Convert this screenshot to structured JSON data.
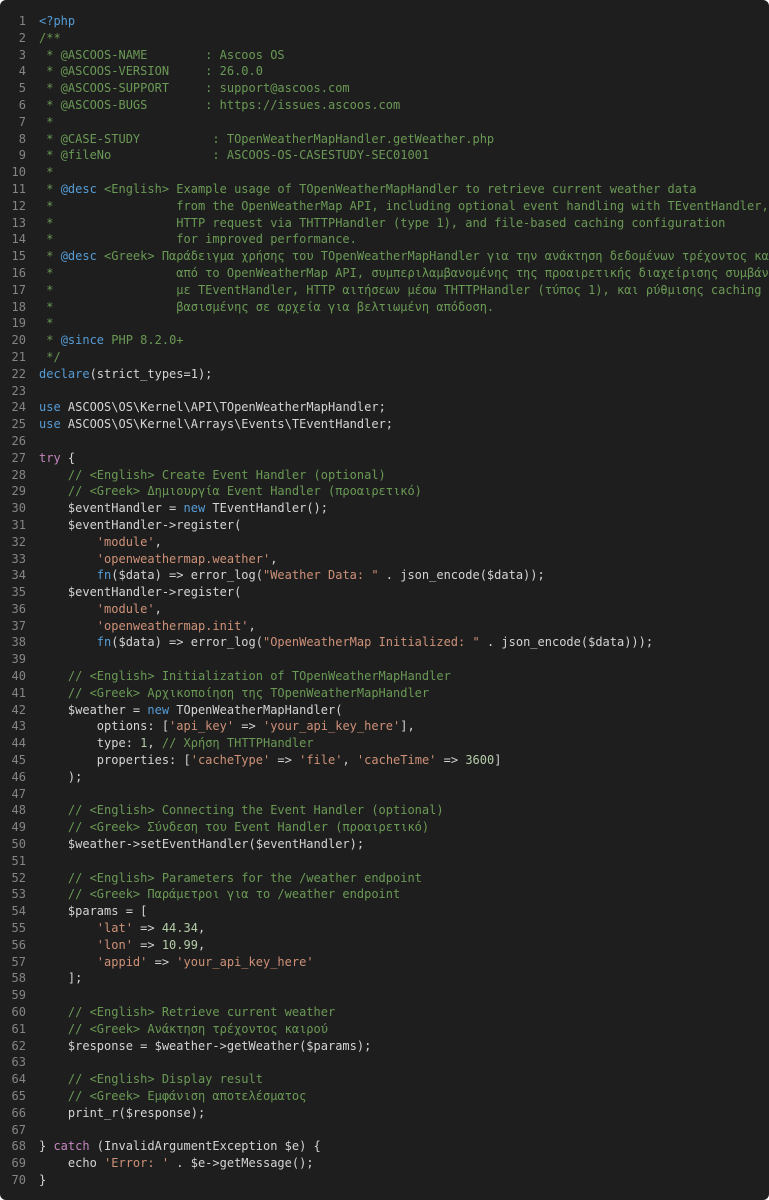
{
  "code_lines": [
    {
      "n": "1",
      "tokens": [
        {
          "t": "<?php",
          "c": "kw"
        }
      ]
    },
    {
      "n": "2",
      "tokens": [
        {
          "t": "/**",
          "c": "cm"
        }
      ]
    },
    {
      "n": "3",
      "tokens": [
        {
          "t": " * @ASCOOS-NAME        : Ascoos OS",
          "c": "cm"
        }
      ]
    },
    {
      "n": "4",
      "tokens": [
        {
          "t": " * @ASCOOS-VERSION     : 26.0.0",
          "c": "cm"
        }
      ]
    },
    {
      "n": "5",
      "tokens": [
        {
          "t": " * @ASCOOS-SUPPORT     : support@ascoos.com",
          "c": "cm"
        }
      ]
    },
    {
      "n": "6",
      "tokens": [
        {
          "t": " * @ASCOOS-BUGS        : https://issues.ascoos.com",
          "c": "cm"
        }
      ]
    },
    {
      "n": "7",
      "tokens": [
        {
          "t": " *",
          "c": "cm"
        }
      ]
    },
    {
      "n": "8",
      "tokens": [
        {
          "t": " * @CASE-STUDY          : TOpenWeatherMapHandler.getWeather.php",
          "c": "cm"
        }
      ]
    },
    {
      "n": "9",
      "tokens": [
        {
          "t": " * @fileNo              : ASCOOS-OS-CASESTUDY-SEC01001",
          "c": "cm"
        }
      ]
    },
    {
      "n": "10",
      "tokens": [
        {
          "t": " *",
          "c": "cm"
        }
      ]
    },
    {
      "n": "11",
      "tokens": [
        {
          "t": " * ",
          "c": "cm"
        },
        {
          "t": "@desc",
          "c": "ck"
        },
        {
          "t": " <English> Example usage of TOpenWeatherMapHandler to retrieve current weather data",
          "c": "cm"
        }
      ]
    },
    {
      "n": "12",
      "tokens": [
        {
          "t": " *                 from the OpenWeatherMap API, including optional event handling with TEventHandler,",
          "c": "cm"
        }
      ]
    },
    {
      "n": "13",
      "tokens": [
        {
          "t": " *                 HTTP request via THTTPHandler (type 1), and file-based caching configuration",
          "c": "cm"
        }
      ]
    },
    {
      "n": "14",
      "tokens": [
        {
          "t": " *                 for improved performance.",
          "c": "cm"
        }
      ]
    },
    {
      "n": "15",
      "tokens": [
        {
          "t": " * ",
          "c": "cm"
        },
        {
          "t": "@desc",
          "c": "ck"
        },
        {
          "t": " <Greek> Παράδειγμα χρήσης του TOpenWeatherMapHandler για την ανάκτηση δεδομένων τρέχοντος καιρού",
          "c": "cm"
        }
      ]
    },
    {
      "n": "16",
      "tokens": [
        {
          "t": " *                 από το OpenWeatherMap API, συμπεριλαμβανομένης της προαιρετικής διαχείρισης συμβάντων",
          "c": "cm"
        }
      ]
    },
    {
      "n": "17",
      "tokens": [
        {
          "t": " *                 με TEventHandler, HTTP αιτήσεων μέσω THTTPHandler (τύπος 1), και ρύθμισης caching",
          "c": "cm"
        }
      ]
    },
    {
      "n": "18",
      "tokens": [
        {
          "t": " *                 βασισμένης σε αρχεία για βελτιωμένη απόδοση.",
          "c": "cm"
        }
      ]
    },
    {
      "n": "19",
      "tokens": [
        {
          "t": " *",
          "c": "cm"
        }
      ]
    },
    {
      "n": "20",
      "tokens": [
        {
          "t": " * ",
          "c": "cm"
        },
        {
          "t": "@since",
          "c": "ck"
        },
        {
          "t": " PHP 8.2.0+",
          "c": "cm"
        }
      ]
    },
    {
      "n": "21",
      "tokens": [
        {
          "t": " */",
          "c": "cm"
        }
      ]
    },
    {
      "n": "22",
      "tokens": [
        {
          "t": "declare",
          "c": "kw"
        },
        {
          "t": "(strict_types=1);",
          "c": ""
        }
      ]
    },
    {
      "n": "23",
      "tokens": []
    },
    {
      "n": "24",
      "tokens": [
        {
          "t": "use",
          "c": "kw"
        },
        {
          "t": " ASCOOS\\OS\\Kernel\\API\\TOpenWeatherMapHandler;",
          "c": ""
        }
      ]
    },
    {
      "n": "25",
      "tokens": [
        {
          "t": "use",
          "c": "kw"
        },
        {
          "t": " ASCOOS\\OS\\Kernel\\Arrays\\Events\\TEventHandler;",
          "c": ""
        }
      ]
    },
    {
      "n": "26",
      "tokens": []
    },
    {
      "n": "27",
      "tokens": [
        {
          "t": "try",
          "c": "ct"
        },
        {
          "t": " {",
          "c": ""
        }
      ]
    },
    {
      "n": "28",
      "tokens": [
        {
          "t": "    // <English> Create Event Handler (optional)",
          "c": "cm"
        }
      ]
    },
    {
      "n": "29",
      "tokens": [
        {
          "t": "    // <Greek> Δημιουργία Event Handler (προαιρετικό)",
          "c": "cm"
        }
      ]
    },
    {
      "n": "30",
      "tokens": [
        {
          "t": "    $eventHandler = ",
          "c": ""
        },
        {
          "t": "new",
          "c": "kw"
        },
        {
          "t": " TEventHandler();",
          "c": ""
        }
      ]
    },
    {
      "n": "31",
      "tokens": [
        {
          "t": "    $eventHandler->register(",
          "c": ""
        }
      ]
    },
    {
      "n": "32",
      "tokens": [
        {
          "t": "        ",
          "c": ""
        },
        {
          "t": "'module'",
          "c": "str"
        },
        {
          "t": ",",
          "c": ""
        }
      ]
    },
    {
      "n": "33",
      "tokens": [
        {
          "t": "        ",
          "c": ""
        },
        {
          "t": "'openweathermap.weather'",
          "c": "str"
        },
        {
          "t": ",",
          "c": ""
        }
      ]
    },
    {
      "n": "34",
      "tokens": [
        {
          "t": "        ",
          "c": ""
        },
        {
          "t": "fn",
          "c": "kw"
        },
        {
          "t": "($data) => error_log(",
          "c": ""
        },
        {
          "t": "\"Weather Data: \"",
          "c": "str"
        },
        {
          "t": " . json_encode($data));",
          "c": ""
        }
      ]
    },
    {
      "n": "35",
      "tokens": [
        {
          "t": "    $eventHandler->register(",
          "c": ""
        }
      ]
    },
    {
      "n": "36",
      "tokens": [
        {
          "t": "        ",
          "c": ""
        },
        {
          "t": "'module'",
          "c": "str"
        },
        {
          "t": ",",
          "c": ""
        }
      ]
    },
    {
      "n": "37",
      "tokens": [
        {
          "t": "        ",
          "c": ""
        },
        {
          "t": "'openweathermap.init'",
          "c": "str"
        },
        {
          "t": ",",
          "c": ""
        }
      ]
    },
    {
      "n": "38",
      "tokens": [
        {
          "t": "        ",
          "c": ""
        },
        {
          "t": "fn",
          "c": "kw"
        },
        {
          "t": "($data) => error_log(",
          "c": ""
        },
        {
          "t": "\"OpenWeatherMap Initialized: \"",
          "c": "str"
        },
        {
          "t": " . json_encode($data)));",
          "c": ""
        }
      ]
    },
    {
      "n": "39",
      "tokens": []
    },
    {
      "n": "40",
      "tokens": [
        {
          "t": "    // <English> Initialization of TOpenWeatherMapHandler",
          "c": "cm"
        }
      ]
    },
    {
      "n": "41",
      "tokens": [
        {
          "t": "    // <Greek> Αρχικοποίηση της TOpenWeatherMapHandler",
          "c": "cm"
        }
      ]
    },
    {
      "n": "42",
      "tokens": [
        {
          "t": "    $weather = ",
          "c": ""
        },
        {
          "t": "new",
          "c": "kw"
        },
        {
          "t": " TOpenWeatherMapHandler(",
          "c": ""
        }
      ]
    },
    {
      "n": "43",
      "tokens": [
        {
          "t": "        options: [",
          "c": ""
        },
        {
          "t": "'api_key'",
          "c": "str"
        },
        {
          "t": " => ",
          "c": ""
        },
        {
          "t": "'your_api_key_here'",
          "c": "str"
        },
        {
          "t": "],",
          "c": ""
        }
      ]
    },
    {
      "n": "44",
      "tokens": [
        {
          "t": "        type: ",
          "c": ""
        },
        {
          "t": "1",
          "c": "num"
        },
        {
          "t": ", ",
          "c": ""
        },
        {
          "t": "// Χρήση THTTPHandler",
          "c": "cm"
        }
      ]
    },
    {
      "n": "45",
      "tokens": [
        {
          "t": "        properties: [",
          "c": ""
        },
        {
          "t": "'cacheType'",
          "c": "str"
        },
        {
          "t": " => ",
          "c": ""
        },
        {
          "t": "'file'",
          "c": "str"
        },
        {
          "t": ", ",
          "c": ""
        },
        {
          "t": "'cacheTime'",
          "c": "str"
        },
        {
          "t": " => ",
          "c": ""
        },
        {
          "t": "3600",
          "c": "num"
        },
        {
          "t": "]",
          "c": ""
        }
      ]
    },
    {
      "n": "46",
      "tokens": [
        {
          "t": "    );",
          "c": ""
        }
      ]
    },
    {
      "n": "47",
      "tokens": []
    },
    {
      "n": "48",
      "tokens": [
        {
          "t": "    // <English> Connecting the Event Handler (optional)",
          "c": "cm"
        }
      ]
    },
    {
      "n": "49",
      "tokens": [
        {
          "t": "    // <Greek> Σύνδεση του Event Handler (προαιρετικό)",
          "c": "cm"
        }
      ]
    },
    {
      "n": "50",
      "tokens": [
        {
          "t": "    $weather->setEventHandler($eventHandler);",
          "c": ""
        }
      ]
    },
    {
      "n": "51",
      "tokens": []
    },
    {
      "n": "52",
      "tokens": [
        {
          "t": "    // <English> Parameters for the /weather endpoint",
          "c": "cm"
        }
      ]
    },
    {
      "n": "53",
      "tokens": [
        {
          "t": "    // <Greek> Παράμετροι για το /weather endpoint",
          "c": "cm"
        }
      ]
    },
    {
      "n": "54",
      "tokens": [
        {
          "t": "    $params = [",
          "c": ""
        }
      ]
    },
    {
      "n": "55",
      "tokens": [
        {
          "t": "        ",
          "c": ""
        },
        {
          "t": "'lat'",
          "c": "str"
        },
        {
          "t": " => ",
          "c": ""
        },
        {
          "t": "44.34",
          "c": "num"
        },
        {
          "t": ",",
          "c": ""
        }
      ]
    },
    {
      "n": "56",
      "tokens": [
        {
          "t": "        ",
          "c": ""
        },
        {
          "t": "'lon'",
          "c": "str"
        },
        {
          "t": " => ",
          "c": ""
        },
        {
          "t": "10.99",
          "c": "num"
        },
        {
          "t": ",",
          "c": ""
        }
      ]
    },
    {
      "n": "57",
      "tokens": [
        {
          "t": "        ",
          "c": ""
        },
        {
          "t": "'appid'",
          "c": "str"
        },
        {
          "t": " => ",
          "c": ""
        },
        {
          "t": "'your_api_key_here'",
          "c": "str"
        }
      ]
    },
    {
      "n": "58",
      "tokens": [
        {
          "t": "    ];",
          "c": ""
        }
      ]
    },
    {
      "n": "59",
      "tokens": []
    },
    {
      "n": "60",
      "tokens": [
        {
          "t": "    // <English> Retrieve current weather",
          "c": "cm"
        }
      ]
    },
    {
      "n": "61",
      "tokens": [
        {
          "t": "    // <Greek> Ανάκτηση τρέχοντος καιρού",
          "c": "cm"
        }
      ]
    },
    {
      "n": "62",
      "tokens": [
        {
          "t": "    $response = $weather->getWeather($params);",
          "c": ""
        }
      ]
    },
    {
      "n": "63",
      "tokens": []
    },
    {
      "n": "64",
      "tokens": [
        {
          "t": "    // <English> Display result",
          "c": "cm"
        }
      ]
    },
    {
      "n": "65",
      "tokens": [
        {
          "t": "    // <Greek> Εμφάνιση αποτελέσματος",
          "c": "cm"
        }
      ]
    },
    {
      "n": "66",
      "tokens": [
        {
          "t": "    print_r($response);",
          "c": ""
        }
      ]
    },
    {
      "n": "67",
      "tokens": []
    },
    {
      "n": "68",
      "tokens": [
        {
          "t": "} ",
          "c": ""
        },
        {
          "t": "catch",
          "c": "ct"
        },
        {
          "t": " (InvalidArgumentException $e) {",
          "c": ""
        }
      ]
    },
    {
      "n": "69",
      "tokens": [
        {
          "t": "    echo ",
          "c": ""
        },
        {
          "t": "'Error: '",
          "c": "str"
        },
        {
          "t": " . $e->getMessage();",
          "c": ""
        }
      ]
    },
    {
      "n": "70",
      "tokens": [
        {
          "t": "}",
          "c": ""
        }
      ]
    }
  ]
}
